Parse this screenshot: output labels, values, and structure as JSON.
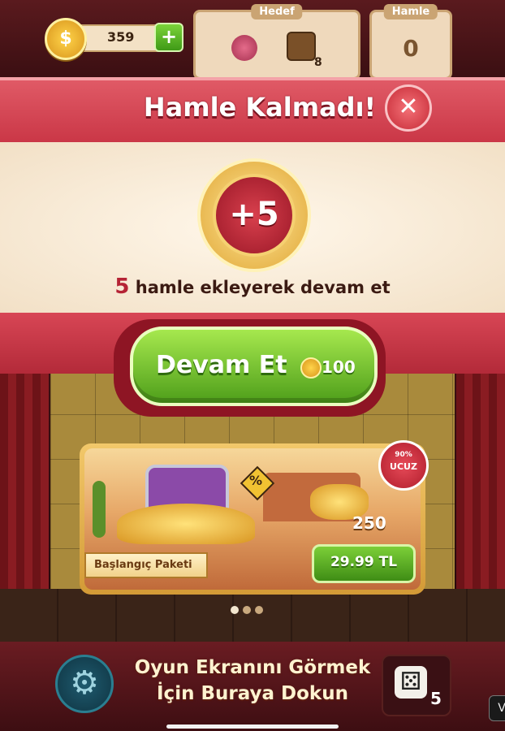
{
  "hud": {
    "coin_symbol": "$",
    "coins": "359",
    "add_coins_label": "+",
    "goal_label": "Hedef",
    "goal_remaining": "8",
    "moves_label": "Hamle",
    "moves_value": "0"
  },
  "modal": {
    "title": "Hamle Kalmadı!",
    "close_label": "✕",
    "bonus_badge": "+5",
    "message_number": "5",
    "message_text": "hamle ekleyerek devam et",
    "continue_label": "Devam Et",
    "continue_price": "100"
  },
  "offer": {
    "discount_percent": "90%",
    "discount_word": "UCUZ",
    "sign_symbol": "%",
    "coin_amount": "250",
    "package_name": "Başlangıç Paketi",
    "price_label": "29.99 TL",
    "carousel_dots": 3,
    "active_dot": 0
  },
  "bottom": {
    "settings_icon": "gear-icon",
    "hint_line1": "Oyun Ekranını Görmek",
    "hint_line2": "İçin Buraya Dokun",
    "dice_count": "5",
    "side_tab": "V"
  },
  "colors": {
    "title_band": "#c93545",
    "continue_button": "#4e9e1a",
    "price_button": "#3f8d15",
    "accent_red": "#b52335"
  }
}
